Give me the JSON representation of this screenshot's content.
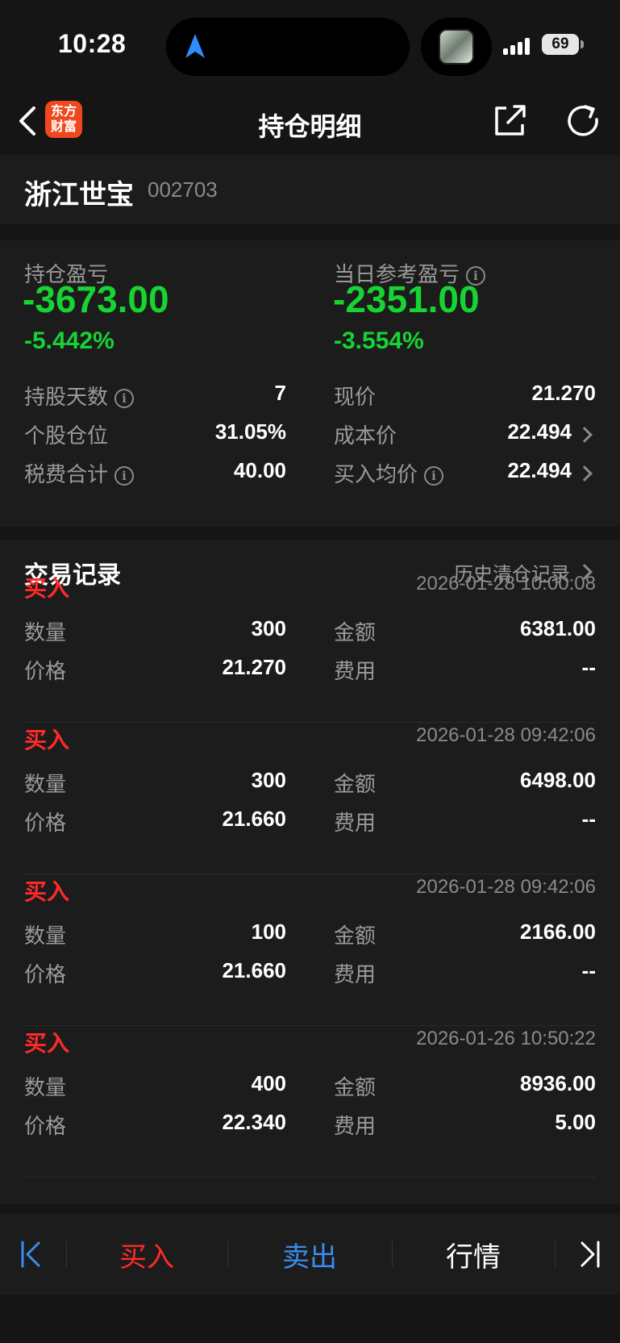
{
  "status": {
    "time": "10:28",
    "battery": "69"
  },
  "header": {
    "logo_text_1": "东方",
    "logo_text_2": "财富",
    "title": "持仓明细"
  },
  "stock": {
    "name": "浙江世宝",
    "code": "002703"
  },
  "summary": {
    "position_pl_label": "持仓盈亏",
    "position_pl_value": "-3673.00",
    "position_pl_pct": "-5.442%",
    "daily_pl_label": "当日参考盈亏",
    "daily_pl_value": "-2351.00",
    "daily_pl_pct": "-3.554%",
    "loss_color": "#16d431",
    "rows": {
      "hold_days_label": "持股天数",
      "hold_days_value": "7",
      "position_ratio_label": "个股仓位",
      "position_ratio_value": "31.05%",
      "fees_label": "税费合计",
      "fees_value": "40.00",
      "price_label": "现价",
      "price_value": "21.270",
      "cost_label": "成本价",
      "cost_value": "22.494",
      "avg_buy_label": "买入均价",
      "avg_buy_value": "22.494"
    }
  },
  "records": {
    "title": "交易记录",
    "history_link": "历史清仓记录",
    "buy_color": "#ff2a2a",
    "labels": {
      "qty": "数量",
      "price": "价格",
      "amount": "金额",
      "fee": "费用"
    },
    "items": [
      {
        "type": "买入",
        "time": "2026-01-28 10:00:08",
        "qty": "300",
        "price": "21.270",
        "amount": "6381.00",
        "fee": "--"
      },
      {
        "type": "买入",
        "time": "2026-01-28 09:42:06",
        "qty": "300",
        "price": "21.660",
        "amount": "6498.00",
        "fee": "--"
      },
      {
        "type": "买入",
        "time": "2026-01-28 09:42:06",
        "qty": "100",
        "price": "21.660",
        "amount": "2166.00",
        "fee": "--"
      },
      {
        "type": "买入",
        "time": "2026-01-26 10:50:22",
        "qty": "400",
        "price": "22.340",
        "amount": "8936.00",
        "fee": "5.00"
      }
    ]
  },
  "bottom": {
    "buy": "买入",
    "sell": "卖出",
    "quote": "行情",
    "buy_color": "#ff2a2a",
    "sell_color": "#3b8cf0"
  }
}
